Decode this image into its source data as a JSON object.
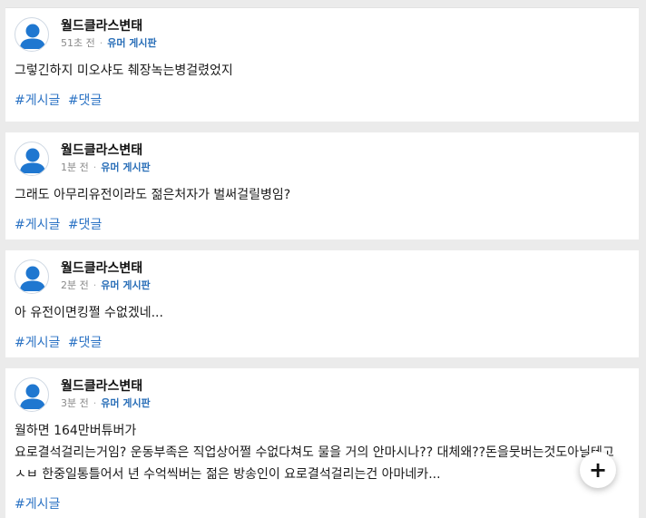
{
  "posts": [
    {
      "author": "월드클라스변태",
      "time": "51초 전",
      "separator": "·",
      "board": "유머 게시판",
      "text": "그렇긴하지 미오샤도 췌장녹는병걸렸었지",
      "tags": [
        "#게시글",
        "#댓글"
      ]
    },
    {
      "author": "월드클라스변태",
      "time": "1분 전",
      "separator": "·",
      "board": "유머 게시판",
      "text": "그래도 아무리유전이라도 젊은처자가 벌써걸릴병임?",
      "tags": [
        "#게시글",
        "#댓글"
      ]
    },
    {
      "author": "월드클라스변태",
      "time": "2분 전",
      "separator": "·",
      "board": "유머 게시판",
      "text": "아 유전이면킹쩔 수없겠네...",
      "tags": [
        "#게시글",
        "#댓글"
      ]
    },
    {
      "author": "월드클라스변태",
      "time": "3분 전",
      "separator": "·",
      "board": "유머 게시판",
      "text": "월하면 164만버튜버가\n요로결석걸리는거임? 운동부족은 직업상어쩔 수없다쳐도 물을 거의 안마시나?? 대체왜??돈을뭇버는것도아닐테고 ㅅㅂ 한중일통틀어서 년 수억씩버는 젊은 방송인이 요로결석걸리는건 아마네카...",
      "tags": [
        "#게시글"
      ]
    }
  ],
  "fab": {
    "icon": "plus-icon",
    "label": "+"
  },
  "colors": {
    "background": "#ebebeb",
    "card": "#ffffff",
    "tag": "#2a72c4",
    "board": "#2a6fb8",
    "avatar": "#1f77d0"
  }
}
